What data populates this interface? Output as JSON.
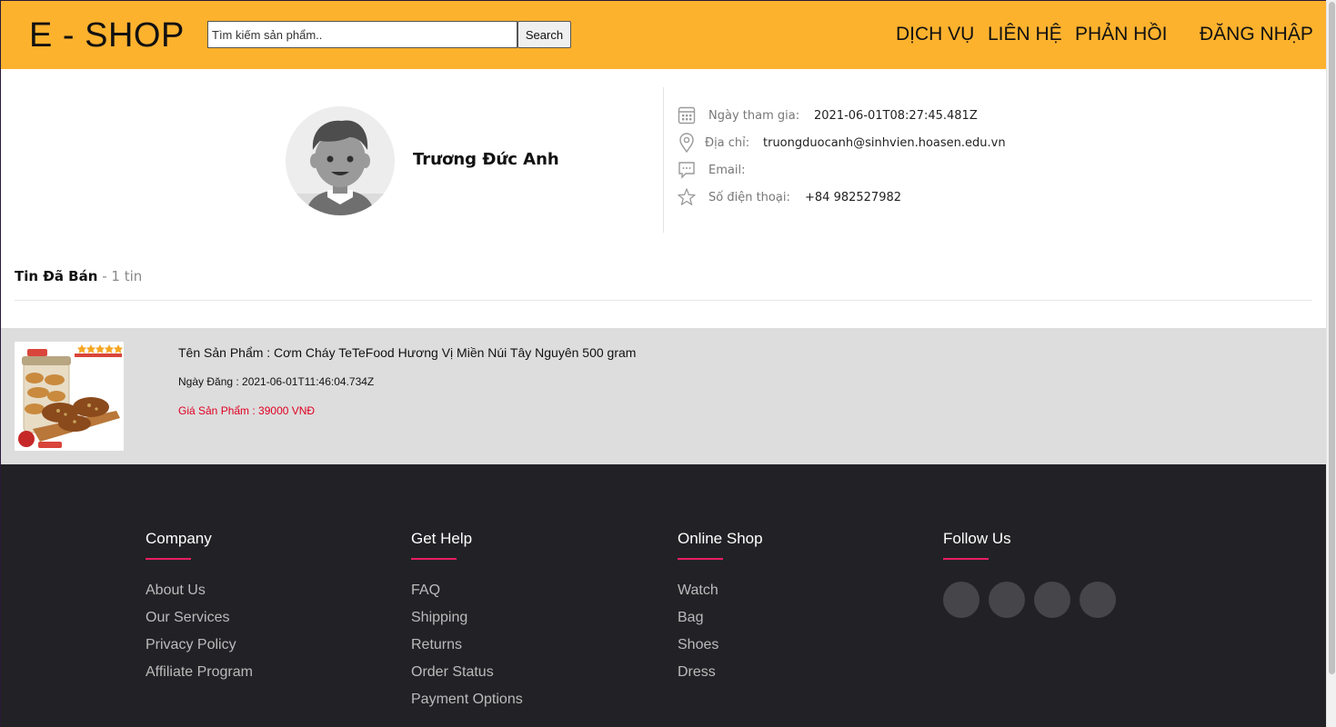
{
  "header": {
    "logo": "E - SHOP",
    "search_placeholder": "Tìm kiếm sản phẩm..",
    "search_button": "Search",
    "nav": [
      "DỊCH VỤ",
      "LIÊN HỆ",
      "PHẢN HỒI",
      "ĐĂNG NHẬP"
    ]
  },
  "profile": {
    "name": "Trương Đức Anh",
    "info": [
      {
        "icon": "calendar-icon",
        "label": "Ngày tham gia:",
        "value": "2021-06-01T08:27:45.481Z"
      },
      {
        "icon": "location-pin-icon",
        "label": "Địa chỉ:",
        "value": "truongduocanh@sinhvien.hoasen.edu.vn"
      },
      {
        "icon": "chat-bubble-icon",
        "label": "Email:",
        "value": ""
      },
      {
        "icon": "star-icon",
        "label": "Số điện thoại:",
        "value": "+84 982527982"
      }
    ]
  },
  "sold": {
    "title": "Tin Đã Bán",
    "count": "- 1 tin"
  },
  "product": {
    "name": "Tên Sản Phẩm : Cơm Cháy TeTeFood Hương Vị Miền Núi Tây Nguyên 500 gram",
    "date": "Ngày Đăng : 2021-06-01T11:46:04.734Z",
    "price": "Giá Sản Phẩm : 39000 VNĐ"
  },
  "footer": {
    "columns": [
      {
        "title": "Company",
        "links": [
          "About Us",
          "Our Services",
          "Privacy Policy",
          "Affiliate Program"
        ]
      },
      {
        "title": "Get Help",
        "links": [
          "FAQ",
          "Shipping",
          "Returns",
          "Order Status",
          "Payment Options"
        ]
      },
      {
        "title": "Online Shop",
        "links": [
          "Watch",
          "Bag",
          "Shoes",
          "Dress"
        ]
      },
      {
        "title": "Follow Us",
        "links": []
      }
    ],
    "social_icons": [
      "facebook-icon",
      "twitter-icon",
      "instagram-icon",
      "linkedin-icon"
    ]
  },
  "colors": {
    "header_bg": "#fdb22e",
    "footer_bg": "#222226",
    "accent": "#e91e63",
    "price": "#e00022"
  }
}
